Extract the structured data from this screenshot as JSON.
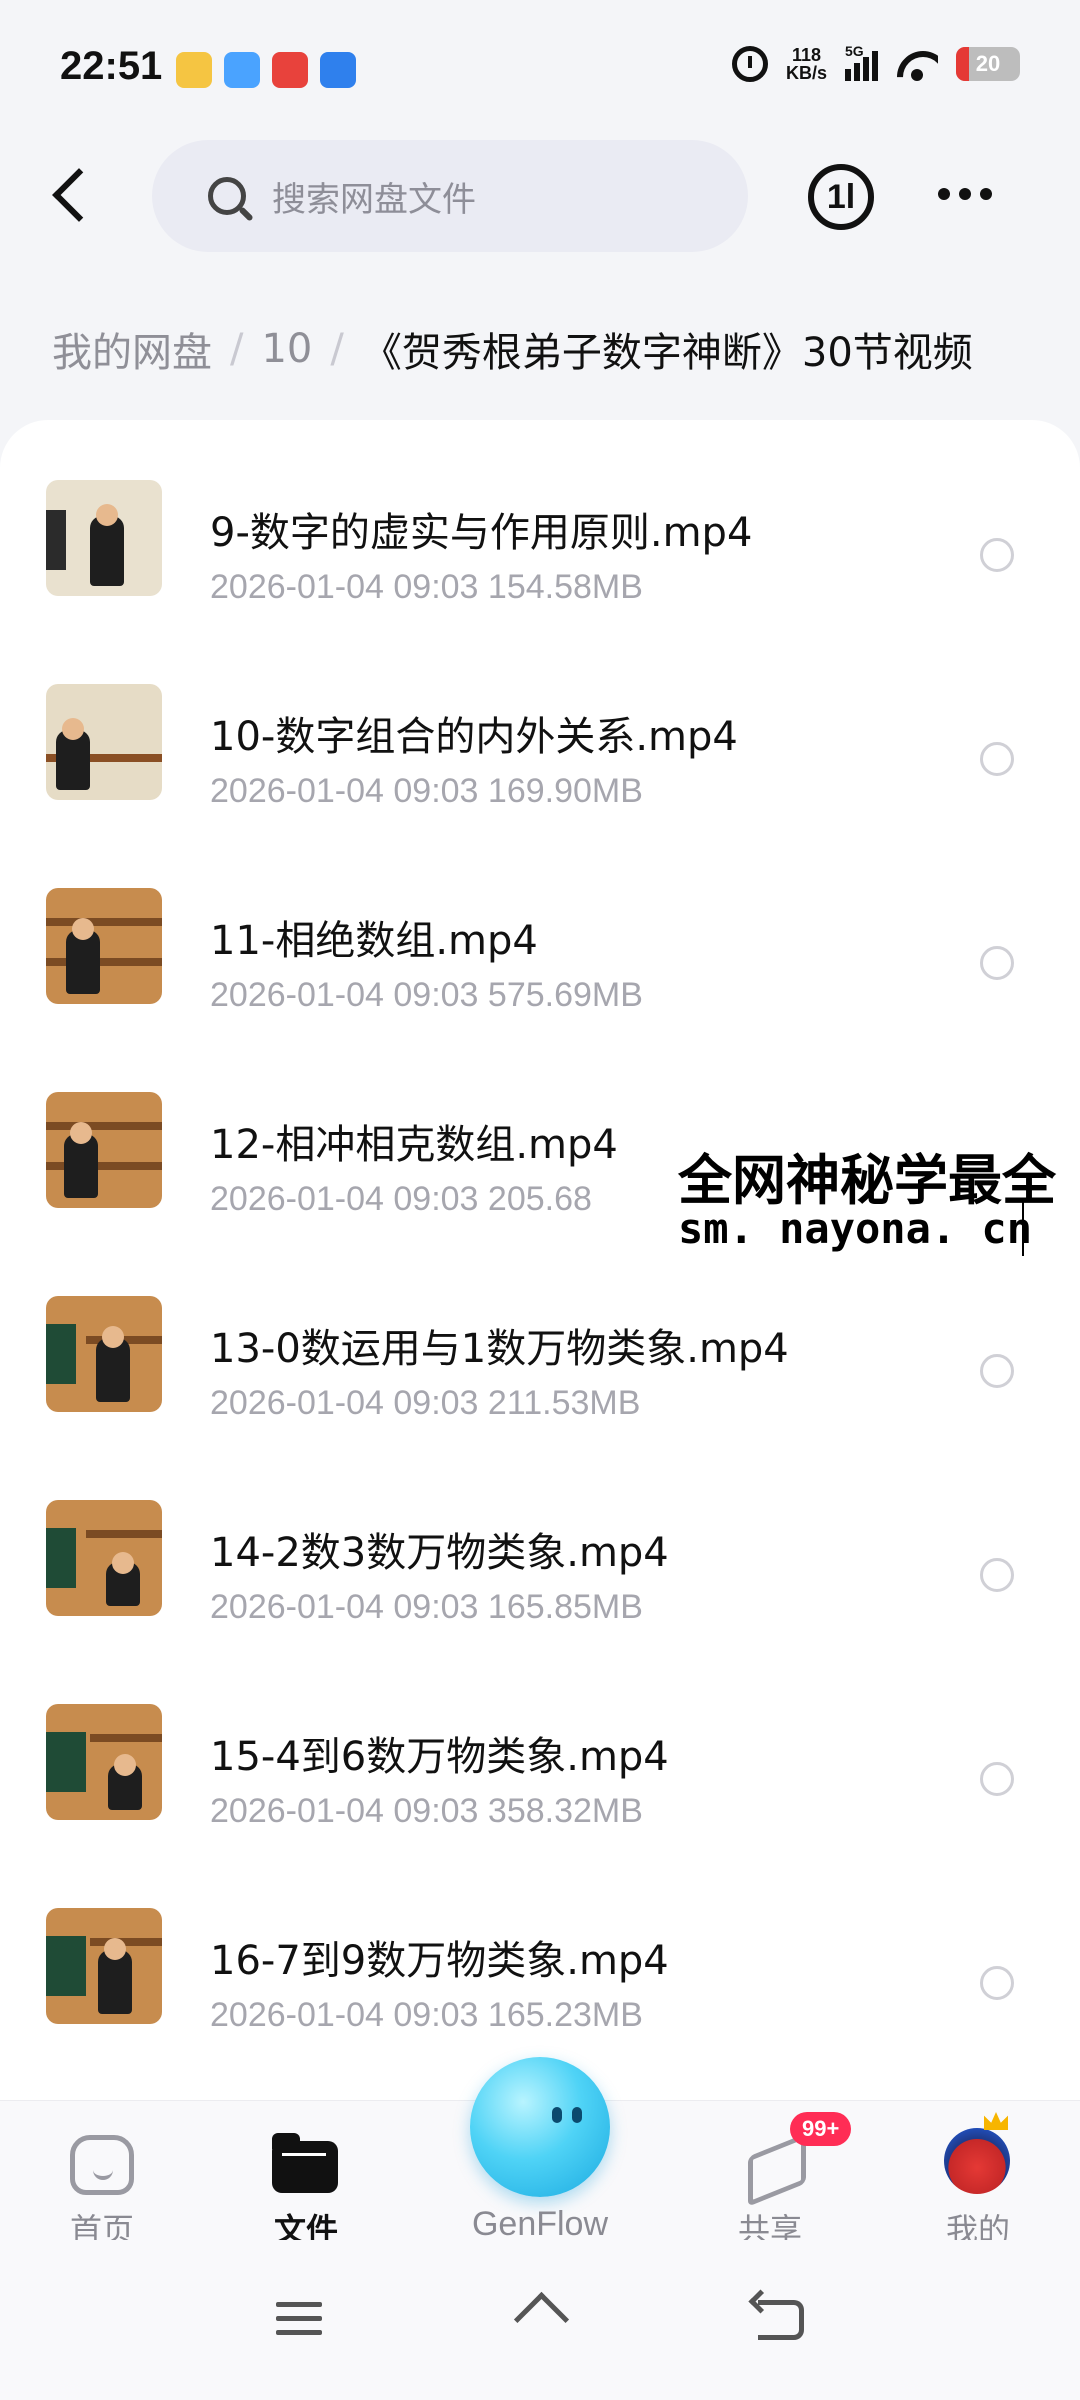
{
  "status_bar": {
    "time": "22:51",
    "net_speed_value": "118",
    "net_speed_unit": "KB/s",
    "network": "5G",
    "battery": "20",
    "app_icon_colors": [
      "#f5c542",
      "#4aa3ff",
      "#e8423c",
      "#2f80ed"
    ]
  },
  "header": {
    "search_placeholder": "搜索网盘文件",
    "sync_icon_label": "1l"
  },
  "breadcrumb": {
    "root": "我的网盘",
    "sep": "/",
    "middle": "10",
    "current": "《贺秀根弟子数字神断》30节视频"
  },
  "files": [
    {
      "name": "9-数字的虚实与作用原则.mp4",
      "date": "2026-01-04",
      "time": "09:03",
      "size": "154.58MB"
    },
    {
      "name": "10-数字组合的内外关系.mp4",
      "date": "2026-01-04",
      "time": "09:03",
      "size": "169.90MB"
    },
    {
      "name": "11-相绝数组.mp4",
      "date": "2026-01-04",
      "time": "09:03",
      "size": "575.69MB"
    },
    {
      "name": "12-相冲相克数组.mp4",
      "date": "2026-01-04",
      "time": "09:03",
      "size": "205.68"
    },
    {
      "name": "13-0数运用与1数万物类象.mp4",
      "date": "2026-01-04",
      "time": "09:03",
      "size": "211.53MB"
    },
    {
      "name": "14-2数3数万物类象.mp4",
      "date": "2026-01-04",
      "time": "09:03",
      "size": "165.85MB"
    },
    {
      "name": "15-4到6数万物类象.mp4",
      "date": "2026-01-04",
      "time": "09:03",
      "size": "358.32MB"
    },
    {
      "name": "16-7到9数万物类象.mp4",
      "date": "2026-01-04",
      "time": "09:03",
      "size": "165.23MB"
    }
  ],
  "watermark": {
    "title": "全网神秘学最全",
    "url": "sm. nayona. cn"
  },
  "bottom_nav": {
    "home": "首页",
    "files": "文件",
    "genflow": "GenFlow",
    "share": "共享",
    "share_badge": "99+",
    "mine": "我的"
  },
  "colors": {
    "accent_badge": "#ff2d55",
    "genflow_blue": "#4fd3f6"
  }
}
